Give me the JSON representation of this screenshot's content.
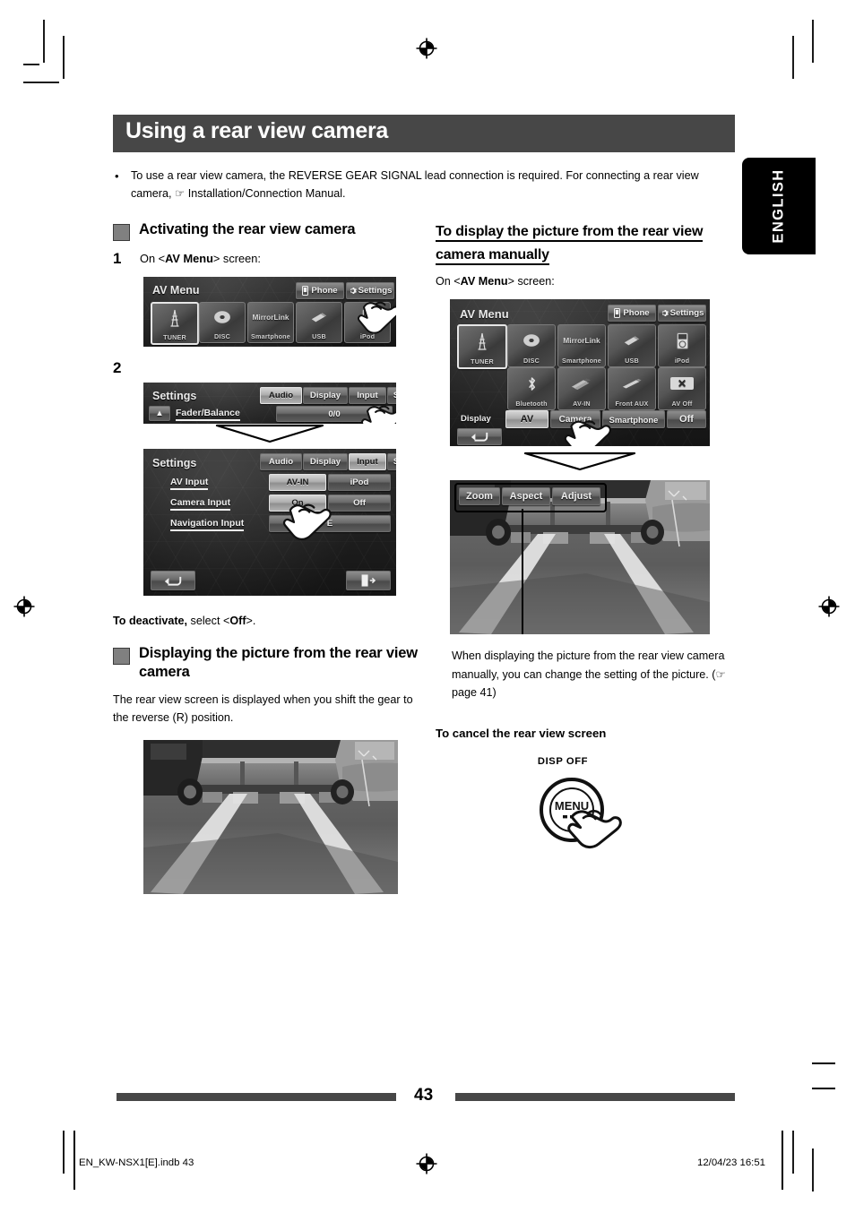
{
  "page": {
    "title": "Using a rear view camera",
    "language_tab": "ENGLISH",
    "number": "43",
    "footer_left": "EN_KW-NSX1[E].indb   43",
    "footer_right": "12/04/23   16:51",
    "accent_dark": "#474747",
    "marker_gray": "#808080"
  },
  "intro": {
    "bullet_dot": "•",
    "text": "To use a rear view camera, the REVERSE GEAR SIGNAL lead connection is required. For connecting a rear view camera, ☞ Installation/Connection Manual."
  },
  "left": {
    "heading1": "Activating the rear view camera",
    "step1": {
      "num": "1",
      "text_prefix": "On <",
      "text_bold": "AV Menu",
      "text_suffix": "> screen:"
    },
    "step2": {
      "num": "2"
    },
    "av_menu_1": {
      "title": "AV Menu",
      "phone_label": "Phone",
      "settings_label": "Settings",
      "sources": [
        "TUNER",
        "DISC",
        "Smartphone",
        "USB",
        "iPod"
      ],
      "mirrorlink_label": "MirrorLink"
    },
    "settings_audio": {
      "title": "Settings",
      "tabs": [
        "Audio",
        "Display",
        "Input",
        "System"
      ],
      "selected_tab": "Audio",
      "row_label": "Fader/Balance",
      "row_value": "0/0"
    },
    "settings_input": {
      "title": "Settings",
      "tabs": [
        "Audio",
        "Display",
        "Input",
        "System"
      ],
      "selected_tab": "Input",
      "rows": [
        {
          "label": "AV Input",
          "options": [
            "AV-IN",
            "iPod"
          ],
          "selected": "AV-IN"
        },
        {
          "label": "Camera Input",
          "options": [
            "On",
            "Off"
          ],
          "selected": "On"
        },
        {
          "label": "Navigation Input",
          "options": [
            "E"
          ],
          "selected": "E"
        }
      ],
      "back_icon": "return-arrow-icon",
      "exit_icon": "exit-icon"
    },
    "deactivate": {
      "bold": "To deactivate,",
      "rest": " select <",
      "off_bold": "Off",
      "end": ">."
    },
    "heading2": "Displaying the picture from the rear view camera",
    "body2": "The rear view screen is displayed when you shift the gear to the reverse (R) position."
  },
  "right": {
    "heading1": "To display the picture from the rear view camera manually",
    "on_screen": {
      "prefix": "On <",
      "bold": "AV Menu",
      "suffix": "> screen:"
    },
    "av_menu_2": {
      "title": "AV Menu",
      "phone_label": "Phone",
      "settings_label": "Settings",
      "mirrorlink_label": "MirrorLink",
      "sources_row1": [
        "TUNER",
        "DISC",
        "Smartphone",
        "USB",
        "iPod"
      ],
      "sources_row2": [
        "Bluetooth",
        "AV-IN",
        "Front AUX",
        "AV Off"
      ],
      "display_label": "Display",
      "display_options": [
        "AV",
        "Camera",
        "Smartphone",
        "Off"
      ],
      "selected_display": "AV",
      "back_icon": "return-arrow-icon"
    },
    "camera_view": {
      "buttons": [
        "Zoom",
        "Aspect",
        "Adjust"
      ]
    },
    "note": "When displaying the picture from the rear view camera manually, you can change the setting of the picture. (☞ page 41)",
    "heading_cancel": "To cancel the rear view screen",
    "knob": {
      "disp_off": "DISP OFF",
      "menu_label": "MENU"
    }
  }
}
